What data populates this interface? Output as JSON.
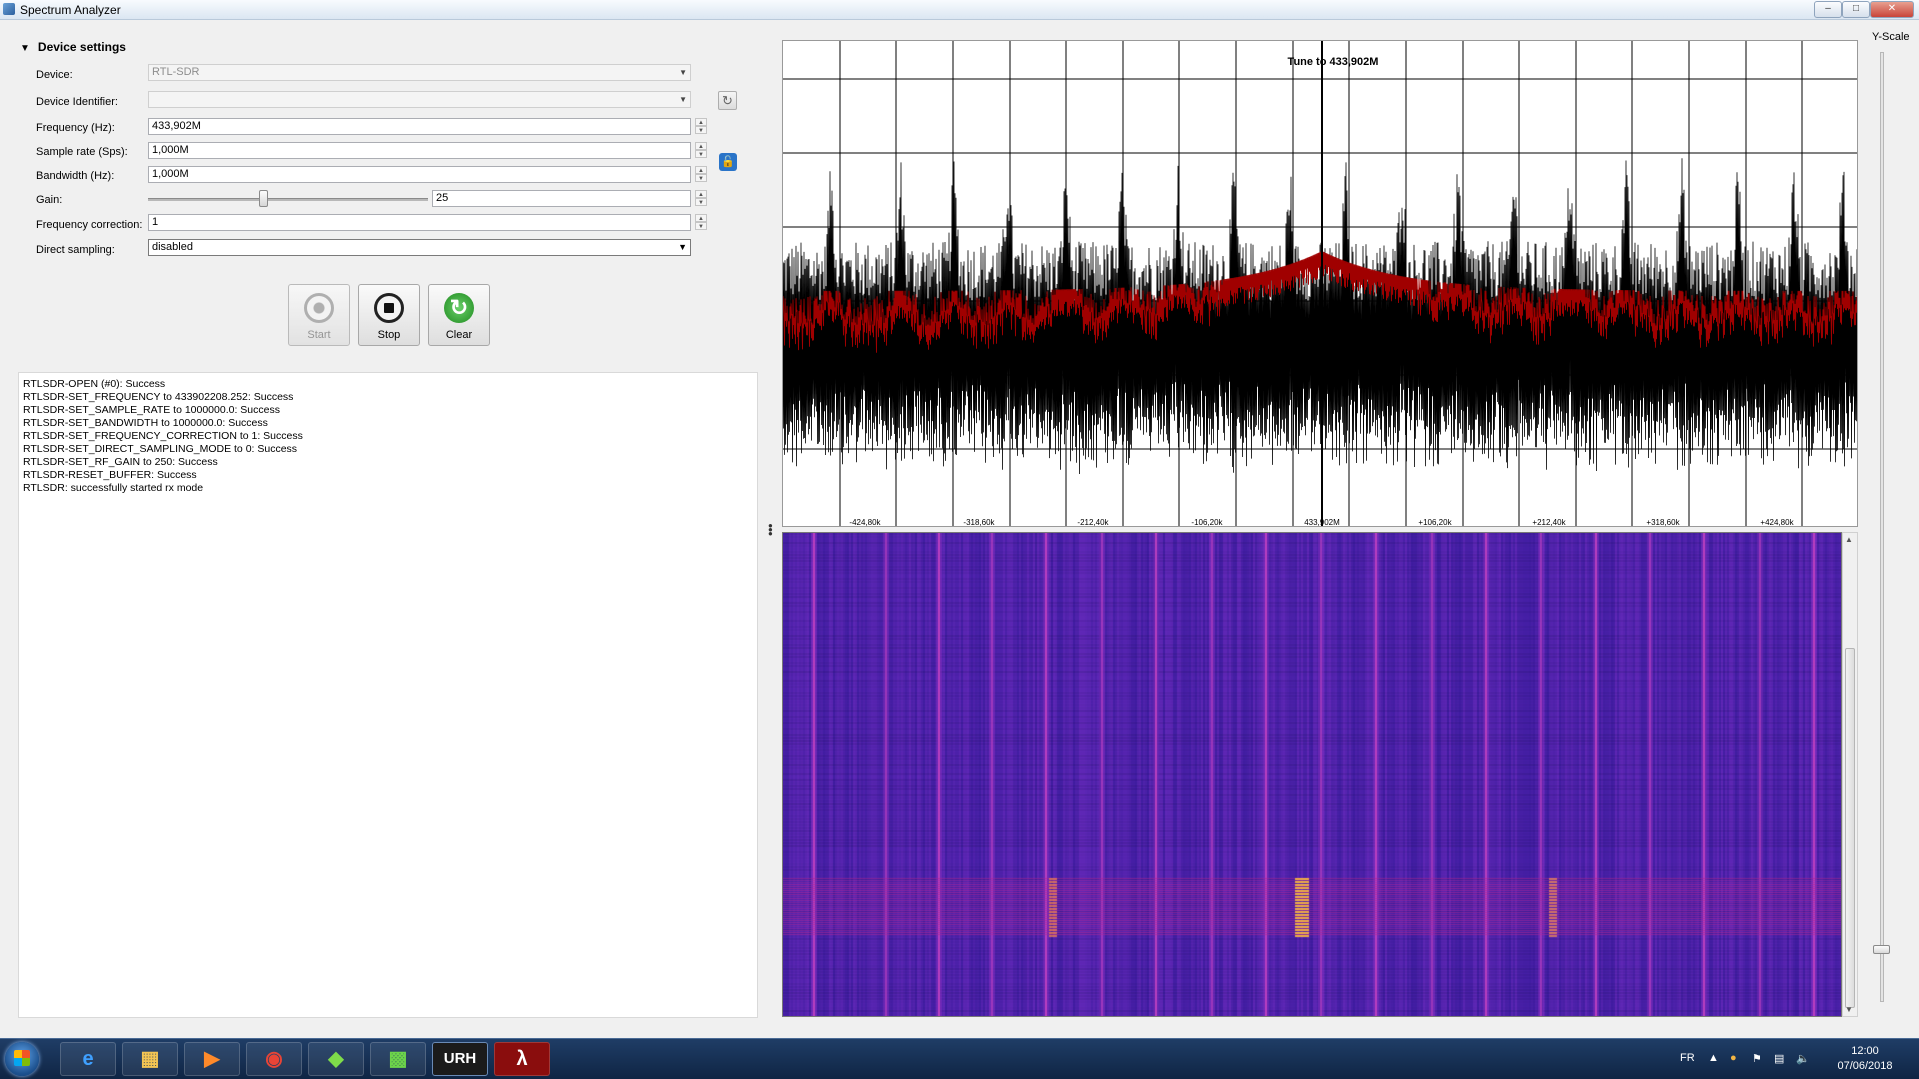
{
  "window": {
    "title": "Spectrum Analyzer"
  },
  "device_settings": {
    "header": "Device settings",
    "device_label": "Device:",
    "device_value": "RTL-SDR",
    "identifier_label": "Device Identifier:",
    "identifier_value": "",
    "frequency_label": "Frequency (Hz):",
    "frequency_value": "433,902M",
    "sample_rate_label": "Sample rate (Sps):",
    "sample_rate_value": "1,000M",
    "bandwidth_label": "Bandwidth (Hz):",
    "bandwidth_value": "1,000M",
    "gain_label": "Gain:",
    "gain_value": "25",
    "gain_slider_fraction": 0.41,
    "freq_correction_label": "Frequency correction:",
    "freq_correction_value": "1",
    "direct_sampling_label": "Direct sampling:",
    "direct_sampling_value": "disabled"
  },
  "buttons": {
    "start": "Start",
    "stop": "Stop",
    "clear": "Clear"
  },
  "log": [
    "RTLSDR-OPEN (#0): Success",
    "RTLSDR-SET_FREQUENCY to 433902208.252: Success",
    "RTLSDR-SET_SAMPLE_RATE to 1000000.0: Success",
    "RTLSDR-SET_BANDWIDTH to 1000000.0: Success",
    "RTLSDR-SET_FREQUENCY_CORRECTION to 1: Success",
    "RTLSDR-SET_DIRECT_SAMPLING_MODE to 0: Success",
    "RTLSDR-SET_RF_GAIN to 250: Success",
    "RTLSDR-RESET_BUFFER: Success",
    "RTLSDR: successfully started rx mode"
  ],
  "spectrum": {
    "annotation": "Tune to 433,902M",
    "x_tick_labels": [
      "-424,80k",
      "-318,60k",
      "-212,40k",
      "-106,20k",
      "433,902M",
      "+106,20k",
      "+212,40k",
      "+318,60k",
      "+424,80k"
    ],
    "peak_color": "#a00000",
    "trace_color": "#000000"
  },
  "y_scale": {
    "label": "Y-Scale"
  },
  "taskbar": {
    "language": "FR",
    "time": "12:00",
    "date": "07/06/2018",
    "urh_label": "URH"
  }
}
